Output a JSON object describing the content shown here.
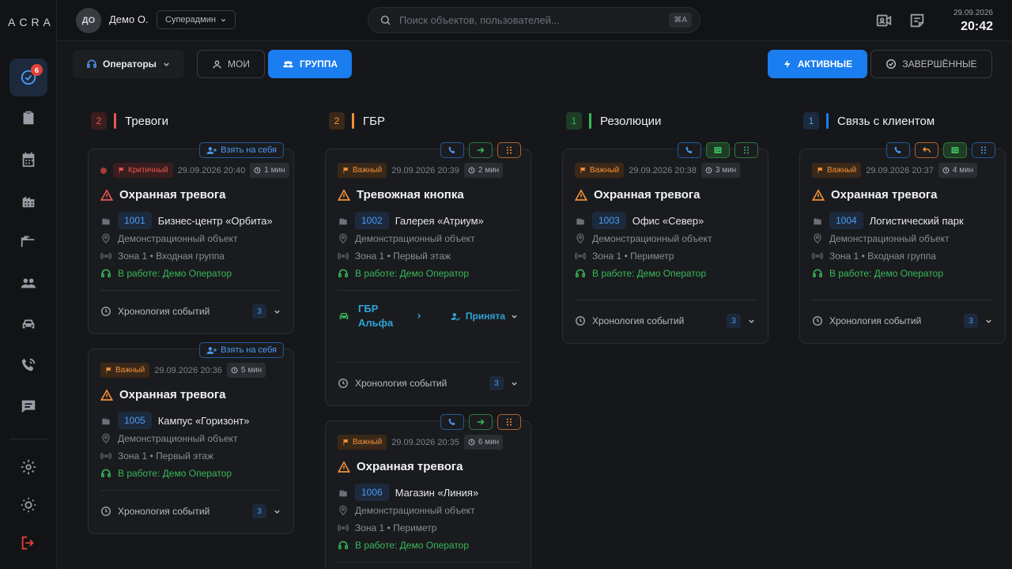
{
  "sidebar": {
    "logo": "ACRA",
    "badge": "6",
    "items": [
      "tasks",
      "clipboard",
      "calendar",
      "buildings",
      "folder",
      "people",
      "car",
      "phone",
      "chat"
    ],
    "bottom": [
      "settings",
      "theme",
      "logout"
    ]
  },
  "header": {
    "avatar": "ДО",
    "user_name": "Демо О.",
    "role": "Суперадмин",
    "search_placeholder": "Поиск объектов, пользователей...",
    "shortcut": "⌘A",
    "date": "29.09.2026",
    "time": "20:42"
  },
  "toolbar": {
    "operators": "Операторы",
    "mine": "МОИ",
    "group": "ГРУППА",
    "active": "АКТИВНЫЕ",
    "done": "ЗАВЕРШЁННЫЕ"
  },
  "columns": [
    {
      "count": "2",
      "title": "Тревоги"
    },
    {
      "count": "2",
      "title": "ГБР"
    },
    {
      "count": "1",
      "title": "Резолюции"
    },
    {
      "count": "1",
      "title": "Связь с клиентом"
    }
  ],
  "common": {
    "take": "Взять на себя",
    "demo_object": "Демонстрационный объект",
    "working": "В работе: Демо Оператор",
    "chronology": "Хронология событий",
    "chrono_count": "3"
  },
  "cards": {
    "c1": {
      "priority": "Критичный",
      "ts": "29.09.2026 20:40",
      "dur": "1 мин",
      "title": "Охранная тревога",
      "num": "1001",
      "object": "Бизнес-центр «Орбита»",
      "zone": "Зона 1 • Входная группа"
    },
    "c2": {
      "priority": "Важный",
      "ts": "29.09.2026 20:36",
      "dur": "5 мин",
      "title": "Охранная тревога",
      "num": "1005",
      "object": "Кампус «Горизонт»",
      "zone": "Зона 1 • Первый этаж"
    },
    "c3": {
      "priority": "Важный",
      "ts": "29.09.2026 20:39",
      "dur": "2 мин",
      "title": "Тревожная кнопка",
      "num": "1002",
      "object": "Галерея «Атриум»",
      "zone": "Зона 1 • Первый этаж",
      "gbr": "ГБР Альфа",
      "gbr_status": "Принята"
    },
    "c4": {
      "priority": "Важный",
      "ts": "29.09.2026 20:35",
      "dur": "6 мин",
      "title": "Охранная тревога",
      "num": "1006",
      "object": "Магазин «Линия»",
      "zone": "Зона 1 • Периметр"
    },
    "c5": {
      "priority": "Важный",
      "ts": "29.09.2026 20:38",
      "dur": "3 мин",
      "title": "Охранная тревога",
      "num": "1003",
      "object": "Офис «Север»",
      "zone": "Зона 1 • Периметр"
    },
    "c6": {
      "priority": "Важный",
      "ts": "29.09.2026 20:37",
      "dur": "4 мин",
      "title": "Охранная тревога",
      "num": "1004",
      "object": "Логистический парк",
      "zone": "Зона 1 • Входная группа"
    }
  },
  "colors": {
    "accent": "#1a7df0",
    "critical": "#e85650",
    "important": "#f0913a",
    "success": "#38b95a",
    "gbr": "#2ea4d8"
  }
}
